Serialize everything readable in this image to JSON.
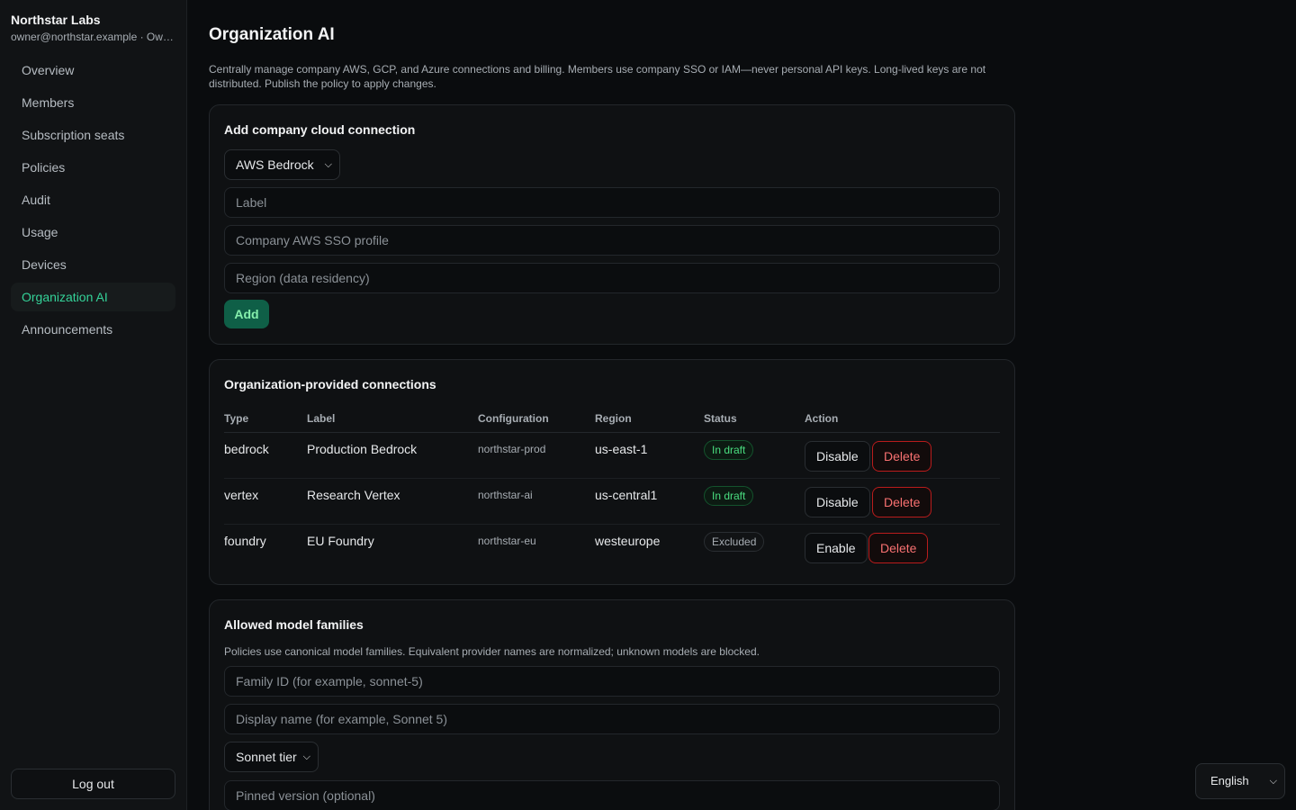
{
  "sidebar": {
    "org_name": "Northstar Labs",
    "org_sub": "owner@northstar.example · Owner",
    "items": [
      {
        "label": "Overview"
      },
      {
        "label": "Members"
      },
      {
        "label": "Subscription seats"
      },
      {
        "label": "Policies"
      },
      {
        "label": "Audit"
      },
      {
        "label": "Usage"
      },
      {
        "label": "Devices"
      },
      {
        "label": "Organization AI",
        "active": true
      },
      {
        "label": "Announcements"
      }
    ],
    "logout_label": "Log out"
  },
  "page": {
    "title": "Organization AI",
    "description": "Centrally manage company AWS, GCP, and Azure connections and billing. Members use company SSO or IAM—never personal API keys. Long-lived keys are not distributed. Publish the policy to apply changes."
  },
  "add_connection": {
    "title": "Add company cloud connection",
    "provider_selected": "AWS Bedrock",
    "label_placeholder": "Label",
    "profile_placeholder": "Company AWS SSO profile",
    "region_placeholder": "Region (data residency)",
    "add_label": "Add"
  },
  "connections": {
    "title": "Organization-provided connections",
    "columns": [
      "Type",
      "Label",
      "Configuration",
      "Region",
      "Status",
      "Action"
    ],
    "rows": [
      {
        "type": "bedrock",
        "label": "Production Bedrock",
        "configuration": "northstar-prod",
        "region": "us-east-1",
        "status": "In draft",
        "toggle": "Disable",
        "delete": "Delete"
      },
      {
        "type": "vertex",
        "label": "Research Vertex",
        "configuration": "northstar-ai",
        "region": "us-central1",
        "status": "In draft",
        "toggle": "Disable",
        "delete": "Delete"
      },
      {
        "type": "foundry",
        "label": "EU Foundry",
        "configuration": "northstar-eu",
        "region": "westeurope",
        "status": "Excluded",
        "toggle": "Enable",
        "delete": "Delete"
      }
    ]
  },
  "model_families": {
    "title": "Allowed model families",
    "description": "Policies use canonical model families. Equivalent provider names are normalized; unknown models are blocked.",
    "family_id_placeholder": "Family ID (for example, sonnet-5)",
    "display_name_placeholder": "Display name (for example, Sonnet 5)",
    "tier_selected": "Sonnet tier",
    "pinned_placeholder": "Pinned version (optional)"
  },
  "language": {
    "selected": "English"
  },
  "icons": {
    "chevron": "chevron-down-icon"
  },
  "colors": {
    "accent": "#34d399",
    "danger": "#f87171",
    "add_button": "#0f5f47"
  }
}
